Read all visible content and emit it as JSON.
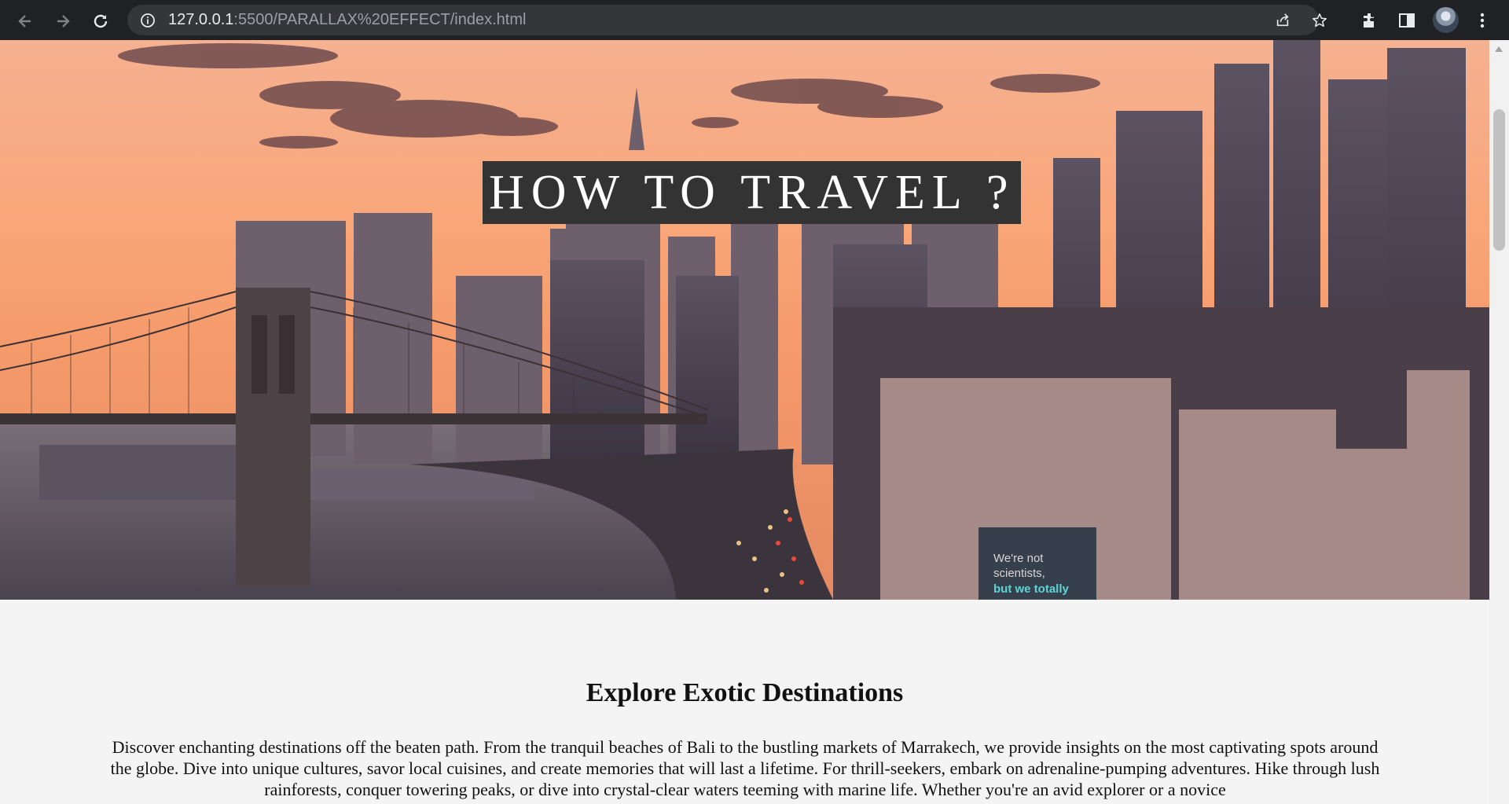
{
  "browser": {
    "url_host": "127.0.0.1",
    "url_rest": ":5500/PARALLAX%20EFFECT/index.html"
  },
  "hero": {
    "title": "HOW TO TRAVEL ?",
    "billboard": [
      "We're not",
      "scientists,",
      "but we totally"
    ]
  },
  "content": {
    "heading": "Explore Exotic Destinations",
    "paragraph": "Discover enchanting destinations off the beaten path. From the tranquil beaches of Bali to the bustling markets of Marrakech, we provide insights on the most captivating spots around the globe. Dive into unique cultures, savor local cuisines, and create memories that will last a lifetime. For thrill-seekers, embark on adrenaline-pumping adventures. Hike through lush rainforests, conquer towering peaks, or dive into crystal-clear waters teeming with marine life. Whether you're an avid explorer or a novice"
  }
}
